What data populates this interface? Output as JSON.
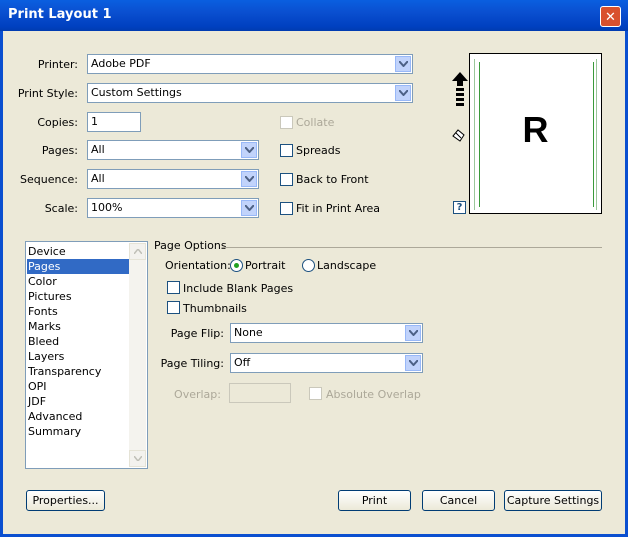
{
  "window": {
    "title": "Print Layout 1",
    "close_glyph": "✕"
  },
  "printer": {
    "label": "Printer:",
    "value": "Adobe PDF"
  },
  "print_style": {
    "label": "Print Style:",
    "value": "Custom Settings"
  },
  "copies": {
    "label": "Copies:",
    "value": "1"
  },
  "pages": {
    "label": "Pages:",
    "value": "All"
  },
  "sequence": {
    "label": "Sequence:",
    "value": "All"
  },
  "scale": {
    "label": "Scale:",
    "value": "100%"
  },
  "checkboxes": {
    "collate": {
      "label": "Collate",
      "checked": false,
      "enabled": false
    },
    "spreads": {
      "label": "Spreads",
      "checked": false
    },
    "back_to_front": {
      "label": "Back to Front",
      "checked": false
    },
    "fit_in_print_area": {
      "label": "Fit in Print Area",
      "checked": false
    }
  },
  "preview": {
    "letter": "R",
    "help": "?"
  },
  "categories": {
    "items": [
      "Device",
      "Pages",
      "Color",
      "Pictures",
      "Fonts",
      "Marks",
      "Bleed",
      "Layers",
      "Transparency",
      "OPI",
      "JDF",
      "Advanced",
      "Summary"
    ],
    "selected": "Pages"
  },
  "page_options": {
    "heading": "Page Options",
    "orientation_label": "Orientation:",
    "portrait": "Portrait",
    "landscape": "Landscape",
    "orientation_selected": "Portrait",
    "include_blank_pages": "Include Blank Pages",
    "thumbnails": "Thumbnails",
    "page_flip_label": "Page Flip:",
    "page_flip_value": "None",
    "page_tiling_label": "Page Tiling:",
    "page_tiling_value": "Off",
    "overlap_label": "Overlap:",
    "overlap_value": "",
    "absolute_overlap": "Absolute Overlap"
  },
  "buttons": {
    "properties": "Properties...",
    "print": "Print",
    "cancel": "Cancel",
    "capture_settings": "Capture Settings"
  },
  "colors": {
    "title_bar": "#0a4fd0",
    "selection": "#316ac5",
    "radio_dot": "#21a121",
    "close": "#d9502d"
  }
}
